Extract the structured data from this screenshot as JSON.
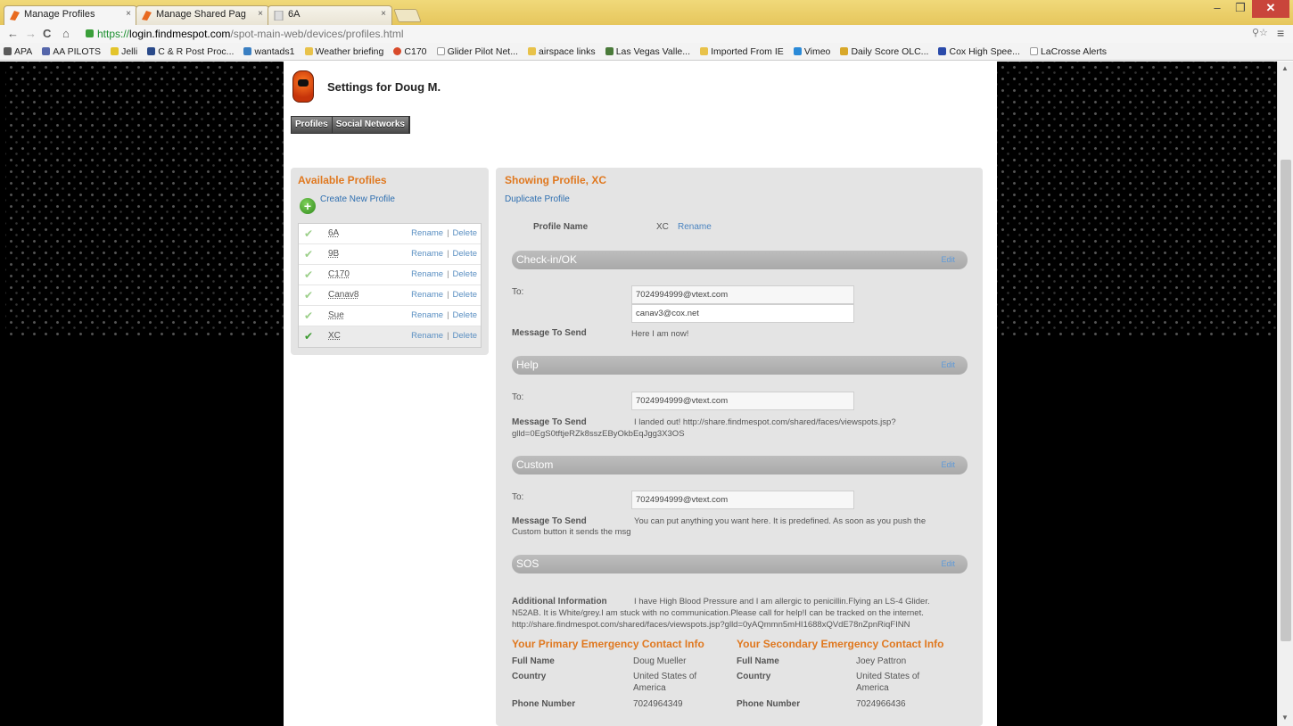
{
  "browser": {
    "tabs": [
      {
        "label": "Manage Profiles",
        "active": true,
        "icon": "spot-favicon"
      },
      {
        "label": "Manage Shared Pag",
        "active": false,
        "icon": "spot-favicon"
      },
      {
        "label": "6A",
        "active": false,
        "icon": "page-favicon"
      }
    ],
    "url": {
      "scheme": "https://",
      "host": "login.findmespot.com",
      "path": "/spot-main-web/devices/profiles.html"
    },
    "window_controls": {
      "minimize": "–",
      "maximize": "❐",
      "close": "✕"
    },
    "bookmarks": [
      "APA",
      "AA PILOTS",
      "Jelli",
      "C & R Post Proc...",
      "wantads1",
      "Weather briefing",
      "C170",
      "Glider Pilot Net...",
      "airspace links",
      "Las Vegas Valle...",
      "Imported From IE",
      "Vimeo",
      "Daily Score OLC...",
      "Cox High Spee...",
      "LaCrosse Alerts"
    ]
  },
  "page": {
    "title": "Settings for Doug M.",
    "subnav": [
      "Profiles",
      "Social Networks"
    ]
  },
  "available_profiles": {
    "title": "Available Profiles",
    "create_label": "Create New Profile",
    "rename_label": "Rename",
    "delete_label": "Delete",
    "separator": "|",
    "profiles": [
      {
        "name": "6A",
        "selected": false
      },
      {
        "name": "9B",
        "selected": false
      },
      {
        "name": "C170",
        "selected": false
      },
      {
        "name": "Canav8",
        "selected": false
      },
      {
        "name": "Sue",
        "selected": false
      },
      {
        "name": "XC",
        "selected": true
      }
    ]
  },
  "showing_profile": {
    "title": "Showing Profile, XC",
    "duplicate_label": "Duplicate Profile",
    "profile_name_label": "Profile Name",
    "profile_name_value": "XC",
    "rename_label": "Rename",
    "edit_label": "Edit",
    "to_label": "To:",
    "message_label": "Message To Send",
    "checkin": {
      "title": "Check-in/OK",
      "recipients": [
        "7024994999@vtext.com",
        "canav3@cox.net"
      ],
      "message": "Here I am now!"
    },
    "help": {
      "title": "Help",
      "recipients": [
        "7024994999@vtext.com"
      ],
      "message_line1": "I landed out! http://share.findmespot.com/shared/faces/viewspots.jsp?",
      "message_line2": "glld=0EgS0tftjeRZk8sszEByOkbEqJgg3X3OS"
    },
    "custom": {
      "title": "Custom",
      "recipients": [
        "7024994999@vtext.com"
      ],
      "message_line1": "You can put anything you want here. It is predefined. As soon as you push the",
      "message_line2": "Custom button it sends the msg"
    },
    "sos": {
      "title": "SOS",
      "additional_label": "Additional Information",
      "line1": "I have High Blood Pressure and I am allergic to penicillin.Flying an LS-4 Glider.",
      "line2": "N52AB. It is White/grey.I am stuck with no communication.Please call for help!I can be tracked on the internet.",
      "line3": "http://share.findmespot.com/shared/faces/viewspots.jsp?glld=0yAQmmn5mHI1688xQVdE78nZpnRiqFINN"
    },
    "primary_contact": {
      "title": "Your Primary Emergency Contact Info",
      "full_name_label": "Full Name",
      "full_name": "Doug Mueller",
      "country_label": "Country",
      "country_line1": "United States of",
      "country_line2": "America",
      "phone_label": "Phone Number",
      "phone": "7024964349"
    },
    "secondary_contact": {
      "title": "Your Secondary Emergency Contact Info",
      "full_name_label": "Full Name",
      "full_name": "Joey Pattron",
      "country_label": "Country",
      "country_line1": "United States of",
      "country_line2": "America",
      "phone_label": "Phone Number",
      "phone": "7024966436"
    }
  }
}
